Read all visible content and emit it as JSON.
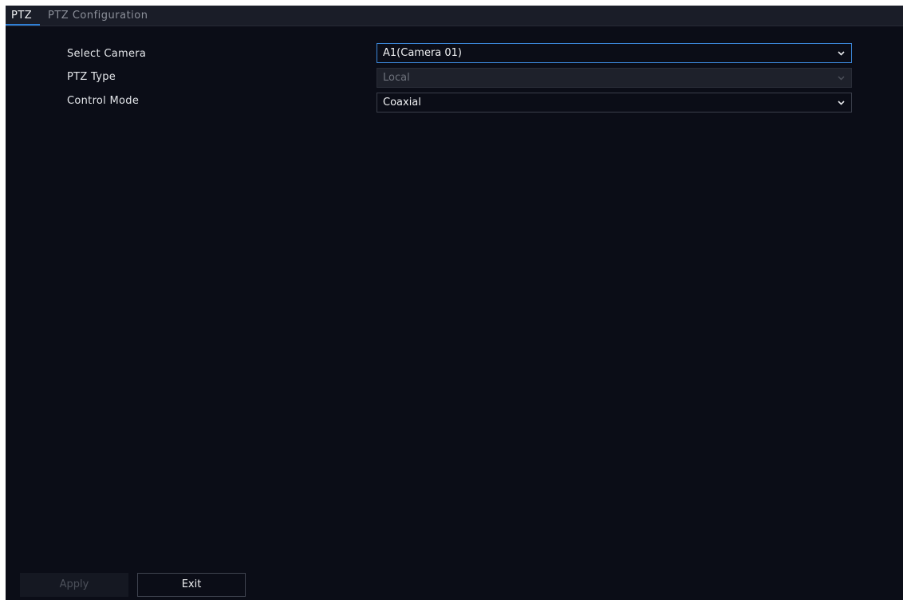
{
  "tabs": [
    {
      "label": "PTZ"
    },
    {
      "label": "PTZ Configuration"
    }
  ],
  "form": {
    "select_camera": {
      "label": "Select Camera",
      "value": "A1(Camera 01)"
    },
    "ptz_type": {
      "label": "PTZ Type",
      "value": "Local"
    },
    "control_mode": {
      "label": "Control Mode",
      "value": "Coaxial"
    }
  },
  "buttons": {
    "apply": "Apply",
    "exit": "Exit"
  },
  "colors": {
    "background": "#0b0d17",
    "accent": "#2f7fd6"
  }
}
